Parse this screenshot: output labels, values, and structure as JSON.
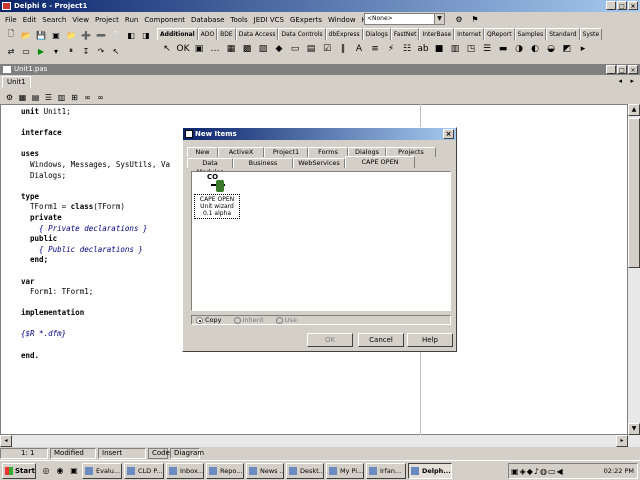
{
  "window": {
    "title": "Delphi 6 - Project1"
  },
  "menu": [
    "File",
    "Edit",
    "Search",
    "View",
    "Project",
    "Run",
    "Component",
    "Database",
    "Tools",
    "JEDI VCS",
    "GExperts",
    "Window",
    "Help"
  ],
  "desktop_combo": "<None>",
  "palette_tabs": [
    "Additional",
    "ADO",
    "BDE",
    "Data Access",
    "Data Controls",
    "dbExpress",
    "Dialogs",
    "FastNet",
    "InterBase",
    "Internet",
    "QReport",
    "Samples",
    "Standard",
    "Syste"
  ],
  "editor": {
    "tab": "Unit1",
    "file_title": "Unit1.pas",
    "lines": [
      [
        {
          "t": "unit ",
          "c": "kw"
        },
        {
          "t": "Unit1;",
          "c": ""
        }
      ],
      [],
      [
        {
          "t": "interface",
          "c": "kw"
        }
      ],
      [],
      [
        {
          "t": "uses",
          "c": "kw"
        }
      ],
      [
        {
          "t": "  Windows, Messages, SysUtils, Va",
          "c": ""
        }
      ],
      [
        {
          "t": "  Dialogs;",
          "c": ""
        }
      ],
      [],
      [
        {
          "t": "type",
          "c": "kw"
        }
      ],
      [
        {
          "t": "  TForm1 = ",
          "c": ""
        },
        {
          "t": "class",
          "c": "kw"
        },
        {
          "t": "(TForm)",
          "c": ""
        }
      ],
      [
        {
          "t": "  private",
          "c": "kw"
        }
      ],
      [
        {
          "t": "    { Private declarations }",
          "c": "cm"
        }
      ],
      [
        {
          "t": "  public",
          "c": "kw"
        }
      ],
      [
        {
          "t": "    { Public declarations }",
          "c": "cm"
        }
      ],
      [
        {
          "t": "  end;",
          "c": "kw"
        }
      ],
      [],
      [
        {
          "t": "var",
          "c": "kw"
        }
      ],
      [
        {
          "t": "  Form1: TForm1;",
          "c": ""
        }
      ],
      [],
      [
        {
          "t": "implementation",
          "c": "kw"
        }
      ],
      [],
      [
        {
          "t": "{$R *.dfm}",
          "c": "cm"
        }
      ],
      [],
      [
        {
          "t": "end.",
          "c": "kw"
        }
      ]
    ]
  },
  "status": {
    "position": "1:  1",
    "modified": "Modified",
    "mode": "Insert",
    "tab_code": "Code",
    "tab_diagram": "Diagram"
  },
  "dialog": {
    "title": "New Items",
    "tabs_row1": [
      "New",
      "ActiveX",
      "Project1",
      "Forms",
      "Dialogs",
      "Projects"
    ],
    "tabs_row2": [
      "Data Modules",
      "Business",
      "WebServices",
      "CAPE OPEN"
    ],
    "item": {
      "icon_text": "CO",
      "label": "CAPE OPEN Unit wizard 0.1 alpha"
    },
    "radio_copy": "Copy",
    "radio_inherit": "Inherit",
    "radio_use": "Use",
    "ok": "OK",
    "cancel": "Cancel",
    "help": "Help"
  },
  "taskbar": {
    "start": "Start",
    "buttons": [
      "Evalu...",
      "CLD P...",
      "Inbox...",
      "Repo...",
      "News ...",
      "Deskt...",
      "My Pi...",
      "Irfan...",
      "Delph..."
    ],
    "clock": "02:22 PM"
  }
}
